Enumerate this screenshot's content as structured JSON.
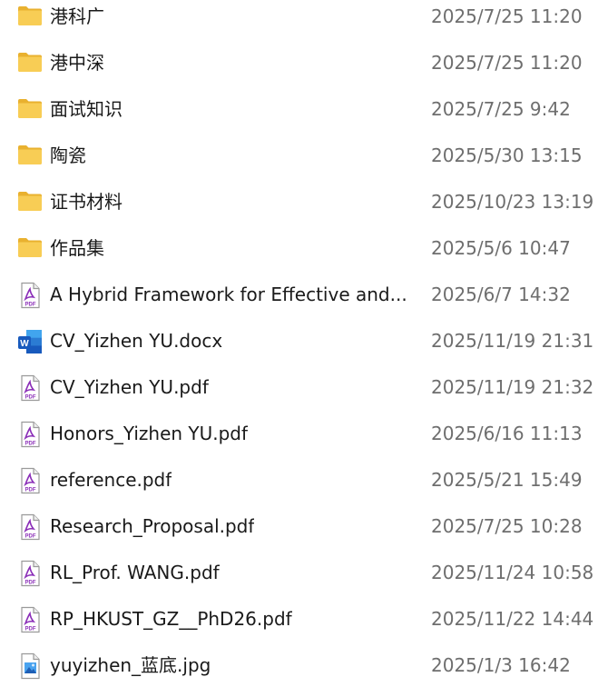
{
  "colors": {
    "name_text": "#1a1a1a",
    "date_text": "#6e6e6e",
    "folder": "#f6c94a",
    "pdf_accent": "#8b2fb8",
    "word_blue": "#185abd",
    "image_blue": "#2f7fd6"
  },
  "files": [
    {
      "name": "港科广",
      "modified": "2025/7/25 11:20",
      "type": "folder",
      "icon": "folder-icon"
    },
    {
      "name": "港中深",
      "modified": "2025/7/25 11:20",
      "type": "folder",
      "icon": "folder-icon"
    },
    {
      "name": "面试知识",
      "modified": "2025/7/25 9:42",
      "type": "folder",
      "icon": "folder-icon"
    },
    {
      "name": "陶瓷",
      "modified": "2025/5/30 13:15",
      "type": "folder",
      "icon": "folder-icon"
    },
    {
      "name": "证书材料",
      "modified": "2025/10/23 13:19",
      "type": "folder",
      "icon": "folder-icon"
    },
    {
      "name": "作品集",
      "modified": "2025/5/6 10:47",
      "type": "folder",
      "icon": "folder-icon"
    },
    {
      "name": "A Hybrid Framework for Effective and...",
      "modified": "2025/6/7 14:32",
      "type": "pdf",
      "icon": "pdf-file-icon"
    },
    {
      "name": "CV_Yizhen YU.docx",
      "modified": "2025/11/19 21:31",
      "type": "docx",
      "icon": "word-file-icon"
    },
    {
      "name": "CV_Yizhen YU.pdf",
      "modified": "2025/11/19 21:32",
      "type": "pdf",
      "icon": "pdf-file-icon"
    },
    {
      "name": "Honors_Yizhen YU.pdf",
      "modified": "2025/6/16 11:13",
      "type": "pdf",
      "icon": "pdf-file-icon"
    },
    {
      "name": "reference.pdf",
      "modified": "2025/5/21 15:49",
      "type": "pdf",
      "icon": "pdf-file-icon"
    },
    {
      "name": "Research_Proposal.pdf",
      "modified": "2025/7/25 10:28",
      "type": "pdf",
      "icon": "pdf-file-icon"
    },
    {
      "name": "RL_Prof. WANG.pdf",
      "modified": "2025/11/24 10:58",
      "type": "pdf",
      "icon": "pdf-file-icon"
    },
    {
      "name": "RP_HKUST_GZ__PhD26.pdf",
      "modified": "2025/11/22 14:44",
      "type": "pdf",
      "icon": "pdf-file-icon"
    },
    {
      "name": "yuyizhen_蓝底.jpg",
      "modified": "2025/1/3 16:42",
      "type": "jpg",
      "icon": "image-file-icon"
    }
  ],
  "icon_labels": {
    "pdf": "PDF",
    "word": "W"
  }
}
